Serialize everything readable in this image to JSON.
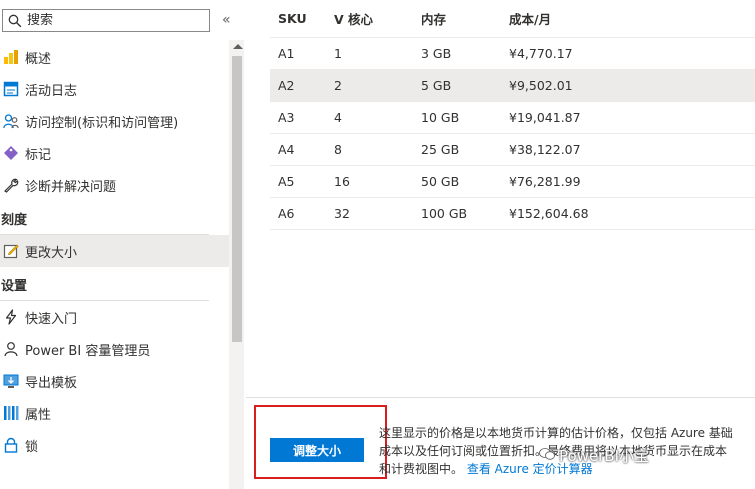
{
  "sidebar": {
    "search_placeholder": "搜索",
    "collapse_label": "«",
    "items_top": [
      {
        "label": "概述",
        "icon": "overview-chart-icon"
      },
      {
        "label": "活动日志",
        "icon": "activity-log-icon"
      },
      {
        "label": "访问控制(标识和访问管理)",
        "icon": "access-control-icon"
      },
      {
        "label": "标记",
        "icon": "tag-icon"
      },
      {
        "label": "诊断并解决问题",
        "icon": "wrench-icon"
      }
    ],
    "section_scale": "刻度",
    "items_scale": [
      {
        "label": "更改大小",
        "icon": "edit-resize-icon",
        "selected": true
      }
    ],
    "section_settings": "设置",
    "items_settings": [
      {
        "label": "快速入门",
        "icon": "lightning-icon"
      },
      {
        "label": "Power BI 容量管理员",
        "icon": "person-icon"
      },
      {
        "label": "导出模板",
        "icon": "export-template-icon"
      },
      {
        "label": "属性",
        "icon": "properties-icon"
      },
      {
        "label": "锁",
        "icon": "lock-icon"
      }
    ]
  },
  "table": {
    "headers": [
      "SKU",
      "V 核心",
      "内存",
      "成本/月"
    ],
    "rows": [
      {
        "sku": "A1",
        "vcores": "1",
        "memory": "3 GB",
        "cost": "¥4,770.17",
        "selected": false
      },
      {
        "sku": "A2",
        "vcores": "2",
        "memory": "5 GB",
        "cost": "¥9,502.01",
        "selected": true
      },
      {
        "sku": "A3",
        "vcores": "4",
        "memory": "10 GB",
        "cost": "¥19,041.87",
        "selected": false
      },
      {
        "sku": "A4",
        "vcores": "8",
        "memory": "25 GB",
        "cost": "¥38,122.07",
        "selected": false
      },
      {
        "sku": "A5",
        "vcores": "16",
        "memory": "50 GB",
        "cost": "¥76,281.99",
        "selected": false
      },
      {
        "sku": "A6",
        "vcores": "32",
        "memory": "100 GB",
        "cost": "¥152,604.68",
        "selected": false
      }
    ]
  },
  "footer": {
    "resize_button": "调整大小",
    "note_line1": "这里显示的价格是以本地货币计算的估计价格，仅包括 Azure 基础",
    "note_line2": "成本以及任何订阅或位置折扣。最终费用将以本地货币显示在成本",
    "note_line3": "和计费视图中。",
    "note_link": "查看 Azure 定价计算器",
    "watermark": "PowerBI小宝"
  },
  "colors": {
    "accent": "#0078d4",
    "selected_bg": "#edebe9",
    "highlight": "#d81e1e"
  }
}
